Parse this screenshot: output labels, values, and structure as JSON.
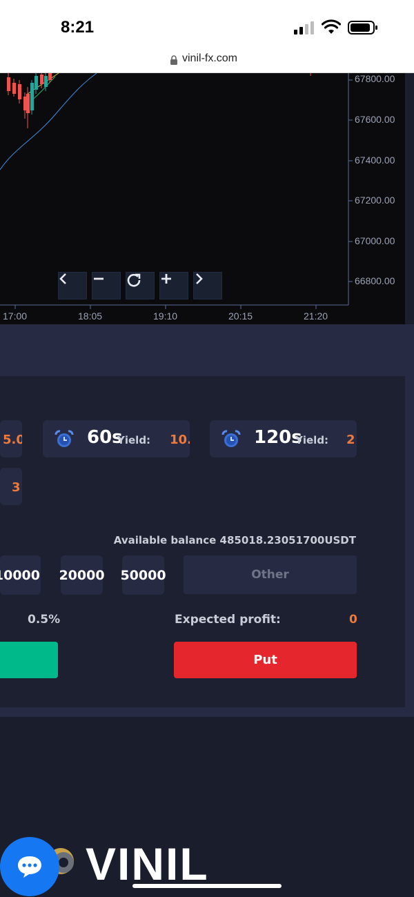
{
  "status_bar": {
    "time": "8:21"
  },
  "browser": {
    "url": "vinil-fx.com"
  },
  "chart": {
    "y_ticks": [
      "67800.00",
      "67600.00",
      "67400.00",
      "67200.00",
      "67000.00",
      "66800.00"
    ],
    "x_ticks": [
      "17:00",
      "18:05",
      "19:10",
      "20:15",
      "21:20"
    ],
    "controls": [
      "prev",
      "zoom-out",
      "reset",
      "zoom-in",
      "next"
    ]
  },
  "periods": [
    {
      "period": "",
      "yield_label": "",
      "yield_value": "5.0"
    },
    {
      "period": "60s",
      "yield_label": "Yield:",
      "yield_value": "10."
    },
    {
      "period": "120s",
      "yield_label": "Yield:",
      "yield_value": "2"
    },
    {
      "period": "",
      "yield_label": "",
      "yield_value": "3"
    }
  ],
  "balance": "Available balance 485018.23051700USDT",
  "amounts": [
    "10000",
    "20000",
    "50000"
  ],
  "other_label": "Other",
  "fee": "0.5%",
  "expected_profit_label": "Expected profit:",
  "expected_profit_value": "0",
  "put_label": "Put",
  "footer": {
    "logo_text": "VINIL"
  },
  "colors": {
    "accent_orange": "#ef7a3c",
    "call_green": "#00b98a",
    "put_red": "#e5262c",
    "chat_blue": "#1677f2"
  }
}
